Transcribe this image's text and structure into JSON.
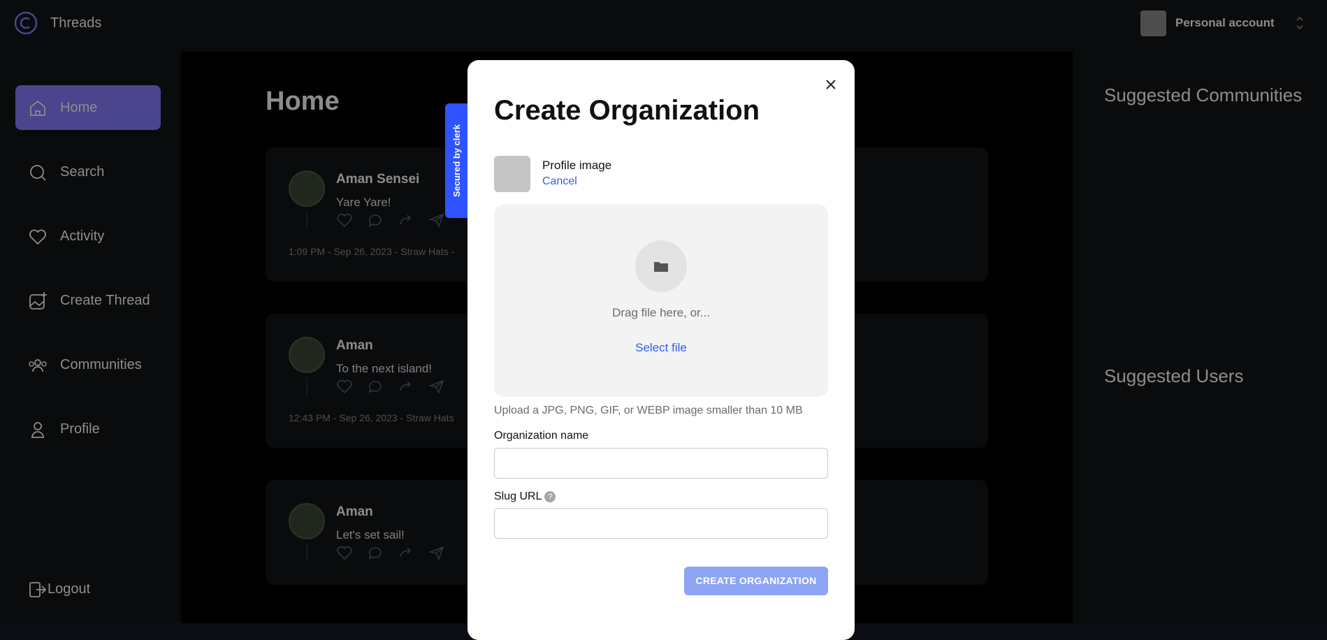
{
  "app": {
    "title": "Threads"
  },
  "account": {
    "label": "Personal account"
  },
  "sidebar": {
    "items": [
      {
        "label": "Home",
        "icon": "home-icon",
        "active": true
      },
      {
        "label": "Search",
        "icon": "search-icon",
        "active": false
      },
      {
        "label": "Activity",
        "icon": "heart-icon",
        "active": false
      },
      {
        "label": "Create Thread",
        "icon": "image-plus-icon",
        "active": false
      },
      {
        "label": "Communities",
        "icon": "users-icon",
        "active": false
      },
      {
        "label": "Profile",
        "icon": "user-icon",
        "active": false
      }
    ],
    "logout": "Logout"
  },
  "main": {
    "title": "Home",
    "threads": [
      {
        "author": "Aman Sensei",
        "text": "Yare Yare!",
        "meta": "1:09 PM - Sep 26, 2023 - Straw Hats -"
      },
      {
        "author": "Aman",
        "text": "To the next island!",
        "meta": "12:43 PM - Sep 26, 2023 - Straw Hats"
      },
      {
        "author": "Aman",
        "text": "Let's set sail!",
        "meta": ""
      }
    ]
  },
  "right_panel": {
    "communities_title": "Suggested Communities",
    "users_title": "Suggested Users"
  },
  "clerk_badge": {
    "text": "Secured by clerk"
  },
  "modal": {
    "title": "Create Organization",
    "profile_image_label": "Profile image",
    "cancel_label": "Cancel",
    "drag_text": "Drag file here, or...",
    "select_file_label": "Select file",
    "upload_hint": "Upload a JPG, PNG, GIF, or WEBP image smaller than 10 MB",
    "org_name_label": "Organization name",
    "org_name_value": "",
    "slug_label": "Slug URL",
    "slug_value": "",
    "submit_label": "CREATE ORGANIZATION"
  },
  "colors": {
    "accent": "#877eff",
    "clerk_blue": "#2f53ff",
    "link_blue": "#335bf1",
    "button": "#8ea5f5"
  }
}
